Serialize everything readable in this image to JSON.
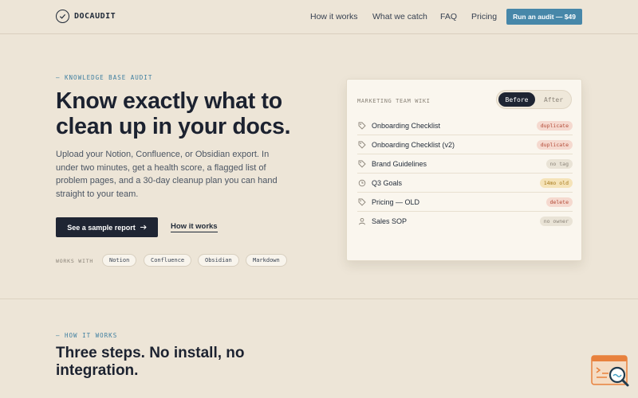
{
  "nav": {
    "brand": "DOCAUDIT",
    "links": [
      "How it works",
      "What we catch",
      "FAQ",
      "Pricing"
    ],
    "cta": "Run an audit — $49"
  },
  "hero": {
    "eyebrow": "— KNOWLEDGE BASE AUDIT",
    "title": "Know exactly what to clean up in your docs.",
    "body": "Upload your Notion, Confluence, or Obsidian export. In under two minutes, get a health score, a flagged list of problem pages, and a 30-day cleanup plan you can hand straight to your team.",
    "primary_button": "See a sample report",
    "secondary_link": "How it works",
    "works_with_label": "WORKS WITH",
    "integrations": [
      "Notion",
      "Confluence",
      "Obsidian",
      "Markdown"
    ]
  },
  "card": {
    "label": "MARKETING TEAM WIKI",
    "toggle": {
      "active": "Before",
      "inactive": "After"
    },
    "rows": [
      {
        "icon": "tag-icon",
        "title": "Onboarding Checklist",
        "tag": "duplicate",
        "tag_kind": "dup"
      },
      {
        "icon": "tag-icon",
        "title": "Onboarding Checklist (v2)",
        "tag": "duplicate",
        "tag_kind": "dup"
      },
      {
        "icon": "tag-icon",
        "title": "Brand Guidelines",
        "tag": "no tag",
        "tag_kind": "none"
      },
      {
        "icon": "clock-icon",
        "title": "Q3 Goals",
        "tag": "14mo old",
        "tag_kind": "old"
      },
      {
        "icon": "tag-icon",
        "title": "Pricing — OLD",
        "tag": "delete",
        "tag_kind": "dup"
      },
      {
        "icon": "person-icon",
        "title": "Sales SOP",
        "tag": "no owner",
        "tag_kind": "none"
      }
    ]
  },
  "how": {
    "eyebrow": "— HOW IT WORKS",
    "title": "Three steps. No install, no integration."
  },
  "colors": {
    "background": "#ede5d7",
    "accent": "#4787a9",
    "dark": "#1f2533",
    "flag_red": "#b24a36",
    "flag_amber": "#a77a1d"
  }
}
